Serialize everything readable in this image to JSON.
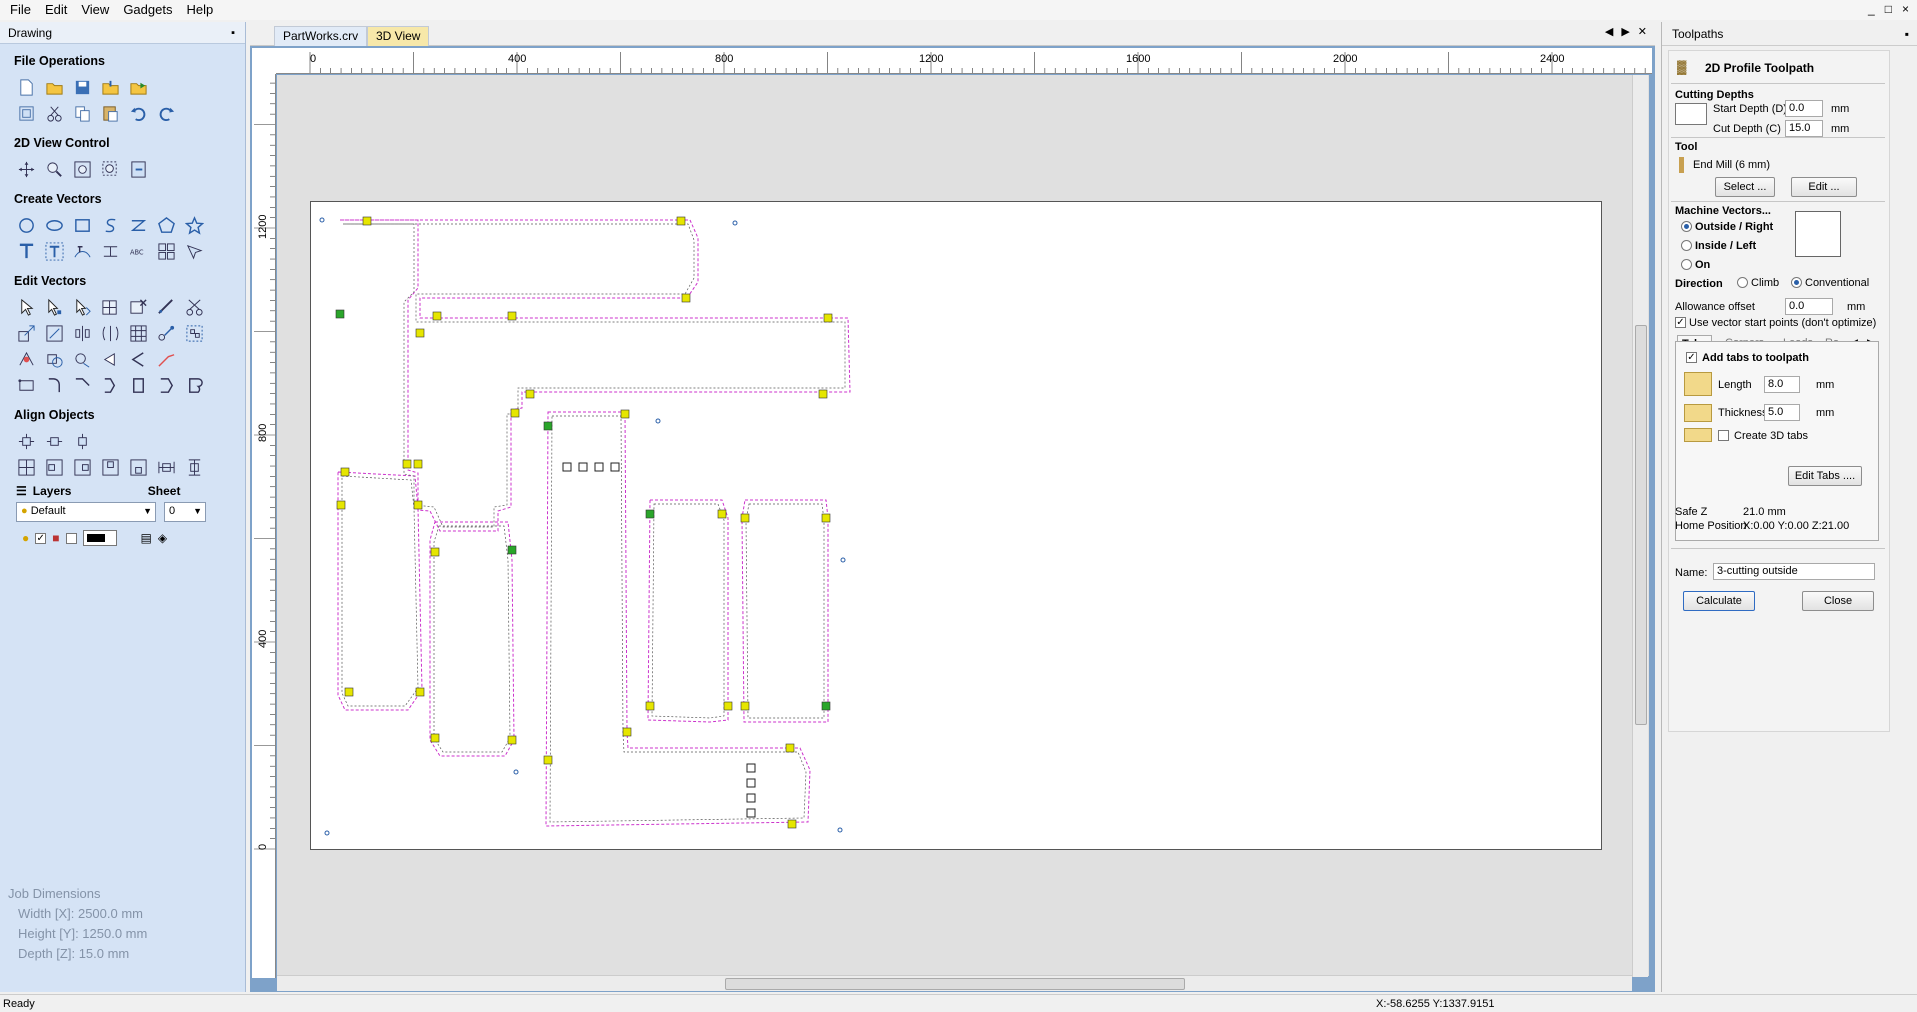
{
  "menu": [
    "File",
    "Edit",
    "View",
    "Gadgets",
    "Help"
  ],
  "window_controls": [
    "_",
    "□",
    "×"
  ],
  "left_panel": {
    "title": "Drawing",
    "sections": {
      "file_ops": "File Operations",
      "view_control": "2D View Control",
      "create_vectors": "Create Vectors",
      "edit_vectors": "Edit Vectors",
      "align_objects": "Align Objects"
    },
    "layers_label": "Layers",
    "sheet_label": "Sheet",
    "layer_value": "Default",
    "sheet_value": "0",
    "job": {
      "title": "Job Dimensions",
      "width": "Width  [X]: 2500.0 mm",
      "height": "Height [Y]: 1250.0 mm",
      "depth": "Depth  [Z]: 15.0 mm"
    }
  },
  "tabs": [
    "PartWorks.crv",
    "3D View"
  ],
  "ruler": {
    "top": [
      "0",
      "400",
      "800",
      "1200",
      "1600",
      "2000",
      "2400"
    ],
    "left": [
      "1200",
      "800",
      "400",
      "0"
    ]
  },
  "right_panel": {
    "title": "Toolpaths",
    "heading": "2D Profile Toolpath",
    "cutting_depths": "Cutting Depths",
    "start_depth_label": "Start Depth (D)",
    "start_depth": "0.0",
    "cut_depth_label": "Cut Depth (C)",
    "cut_depth": "15.0",
    "unit": "mm",
    "tool_label": "Tool",
    "tool_name": "End Mill (6 mm)",
    "select_btn": "Select ...",
    "edit_btn": "Edit ...",
    "machine_vectors": "Machine Vectors...",
    "mv_options": [
      "Outside / Right",
      "Inside / Left",
      "On"
    ],
    "direction_label": "Direction",
    "dir_climb": "Climb",
    "dir_conventional": "Conventional",
    "allowance_label": "Allowance offset",
    "allowance": "0.0",
    "use_start_points": "Use vector start points (don't optimize)",
    "subtabs": [
      "Tabs",
      "Corners",
      "Leads",
      "Ra"
    ],
    "add_tabs": "Add tabs to toolpath",
    "length_label": "Length",
    "length": "8.0",
    "thickness_label": "Thickness",
    "thickness": "5.0",
    "create3d": "Create 3D tabs",
    "edit_tabs_btn": "Edit Tabs ....",
    "safe_z_label": "Safe Z",
    "safe_z": "21.0 mm",
    "home_label": "Home Position",
    "home": "X:0.00 Y:0.00 Z:21.00",
    "name_label": "Name:",
    "name_value": "3-cutting outside",
    "calculate_btn": "Calculate",
    "close_btn": "Close"
  },
  "status": {
    "left": "Ready",
    "coords": "X:-58.6255 Y:1337.9151"
  },
  "colors": {
    "toolpath": "#cc33cc",
    "tab_marker": "#e6e600",
    "panel_bg": "#d5e3f5"
  }
}
